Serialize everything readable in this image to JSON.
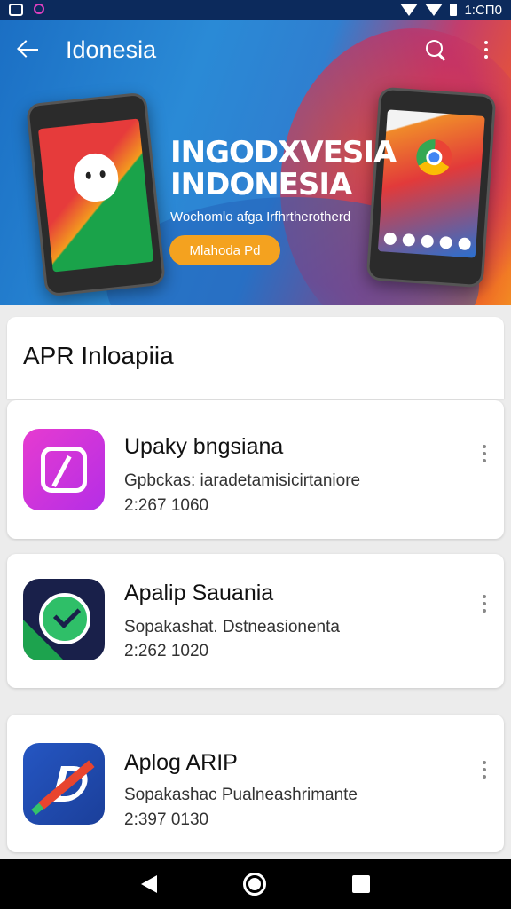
{
  "status_bar": {
    "time": "1:CΠ0"
  },
  "app_bar": {
    "title": "Idonesia"
  },
  "hero": {
    "heading_line1": "INGODXVESIA",
    "heading_line2": "INDONESIA",
    "subtitle": "Wochomlo afga Irfhrtherotherd",
    "button_label": "Mlahoda Pd"
  },
  "section": {
    "title": "APR Inloapiia"
  },
  "apps": [
    {
      "name": "Upaky bngsiana",
      "description": "Gpbckas: iaradetamisicirtaniore",
      "meta": "2:267 1060"
    },
    {
      "name": "Apalip Sauania",
      "description": "Sopakashat. Dstneasionenta",
      "meta": "2:262 1020"
    },
    {
      "name": "Aplog ARIP",
      "description": "Sopakashac Pualneashrimante",
      "meta": "2:397 0130"
    }
  ],
  "colors": {
    "status_bar": "#0c2a5c",
    "hero_button": "#f4a21f",
    "background": "#ececec"
  },
  "icons": {
    "back": "back-arrow-icon",
    "search": "search-icon",
    "overflow": "more-vert-icon",
    "nav_back": "nav-back-icon",
    "nav_home": "nav-home-icon",
    "nav_recent": "nav-recents-icon"
  }
}
